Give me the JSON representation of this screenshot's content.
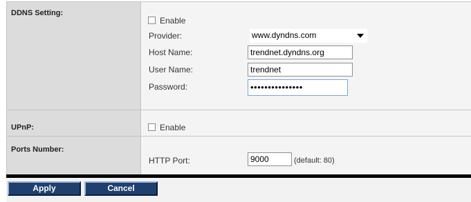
{
  "ddns": {
    "label": "DDNS Setting:",
    "enable_label": "Enable",
    "enabled": false,
    "provider_label": "Provider:",
    "provider_value": "www.dyndns.com",
    "host_label": "Host Name:",
    "host_value": "trendnet.dyndns.org",
    "user_label": "User Name:",
    "user_value": "trendnet",
    "password_label": "Password:",
    "password_mask": "•••••••••••••••"
  },
  "upnp": {
    "label": "UPnP:",
    "enable_label": "Enable",
    "enabled": false
  },
  "ports": {
    "label": "Ports Number:",
    "http_label": "HTTP Port:",
    "http_value": "9000",
    "default_hint": "(default: 80)"
  },
  "buttons": {
    "apply": "Apply",
    "cancel": "Cancel"
  },
  "colors": {
    "button_bg": "#1f3f6e",
    "label_bg": "#dcdcdc",
    "value_bg": "#f4f4f4",
    "focus_border": "#7aa7d8"
  }
}
